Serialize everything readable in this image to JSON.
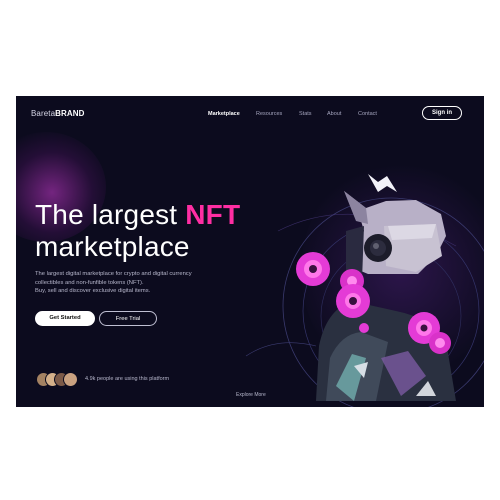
{
  "header": {
    "logo_light": "Bareta",
    "logo_bold": "BRAND",
    "nav": [
      "Marketplace",
      "Resources",
      "Stats",
      "About",
      "Contact"
    ],
    "active_nav": "Marketplace",
    "signin_label": "Sign in"
  },
  "hero": {
    "title_part1": "The largest ",
    "title_highlight": "NFT",
    "title_line2": "marketplace",
    "desc_line1": "The largest digital marketplace for crypto and digital currency",
    "desc_line2": "collectibles and non-funfible tokens (NFT).",
    "desc_line3": "Buy, sell and discover exclusive digital items.",
    "primary_button": "Get Started",
    "secondary_button": "Free Trial"
  },
  "social_proof": {
    "text": "4.9k people are using this platform"
  },
  "explore_label": "Explore More",
  "colors": {
    "background": "#0c0b1e",
    "accent": "#ff2ea3",
    "ring": "#3a3a6e"
  },
  "icons": [
    "bolt-icon",
    "avatar"
  ]
}
